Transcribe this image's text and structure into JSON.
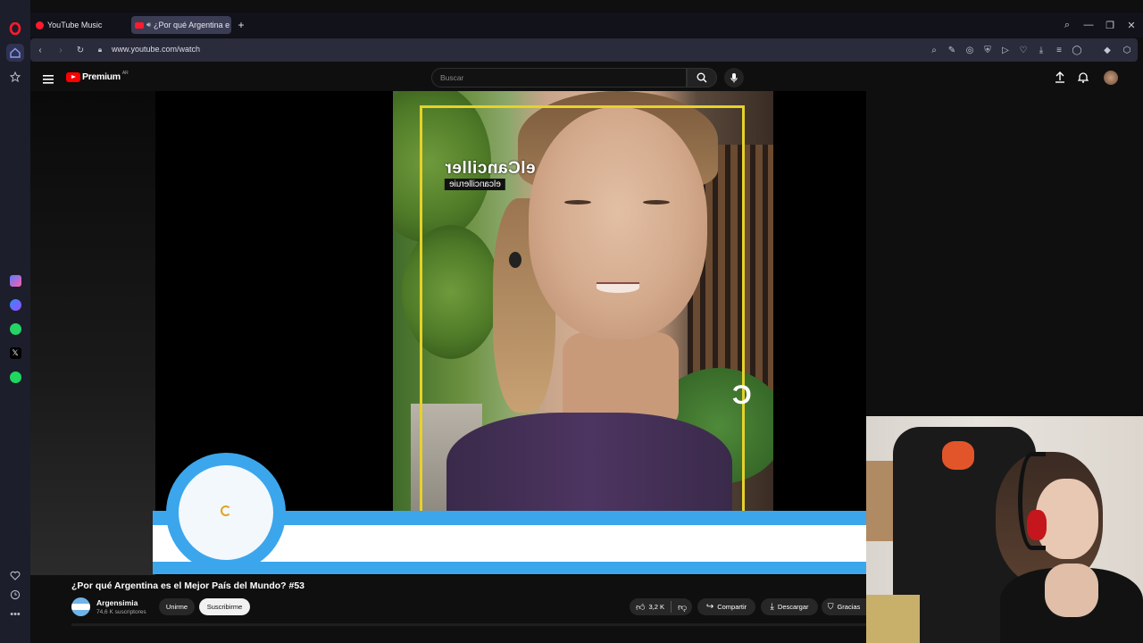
{
  "browser": {
    "tabs": [
      {
        "label": "YouTube Music",
        "active": false
      },
      {
        "label": "¿Por qué Argentina e",
        "active": true
      }
    ],
    "new_tab_symbol": "+",
    "window_buttons": {
      "search": "⌕",
      "minimize": "—",
      "restore": "❐",
      "close": "✕"
    },
    "url": "www.youtube.com/watch",
    "accent_color": "#ff1b2d"
  },
  "sidebar": {
    "top_icons": [
      "opera-logo-icon",
      "home-icon",
      "star-icon"
    ],
    "app_icons": [
      "aria-icon",
      "messenger-icon",
      "whatsapp-icon",
      "x-icon",
      "spotify-icon"
    ],
    "bottom_icons": [
      "heart-icon",
      "history-icon",
      "more-icon"
    ]
  },
  "youtube": {
    "logo_text": "Premium",
    "country_code": "AR",
    "search_placeholder": "Buscar"
  },
  "video": {
    "watermark_name": "elCanciller",
    "watermark_handle": "elcancilleruie",
    "corner_mark": "C"
  },
  "info": {
    "title": "¿Por qué Argentina es el Mejor País del Mundo? #53",
    "channel_name": "Argensimia",
    "subscribers": "74,6 K suscriptores",
    "join_label": "Unirme",
    "subscribe_label": "Suscribirme",
    "likes": "3,2 K",
    "share_label": "Compartir",
    "download_label": "Descargar",
    "thanks_label": "Gracias"
  }
}
